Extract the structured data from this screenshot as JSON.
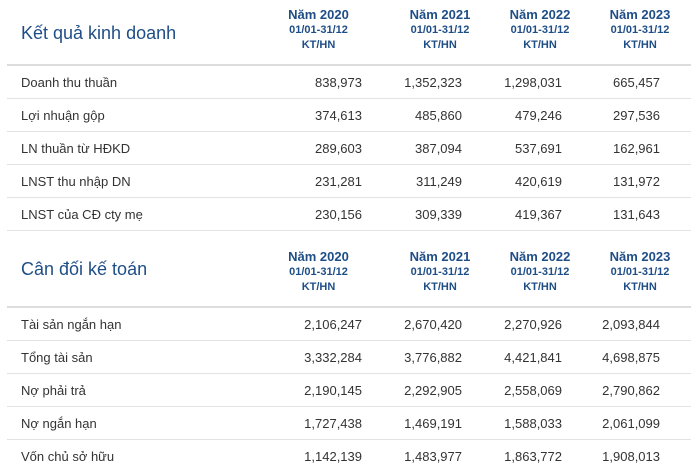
{
  "kqkd": {
    "title": "Kết quả kinh doanh",
    "columns": [
      {
        "year": "Năm 2020",
        "period": "01/01-31/12",
        "unit": "KT/HN"
      },
      {
        "year": "Năm 2021",
        "period": "01/01-31/12",
        "unit": "KT/HN"
      },
      {
        "year": "Năm 2022",
        "period": "01/01-31/12",
        "unit": "KT/HN"
      },
      {
        "year": "Năm 2023",
        "period": "01/01-31/12",
        "unit": "KT/HN"
      }
    ],
    "rows": [
      {
        "label": "Doanh thu thuần",
        "values": [
          "838,973",
          "1,352,323",
          "1,298,031",
          "665,457"
        ]
      },
      {
        "label": "Lợi nhuận gộp",
        "values": [
          "374,613",
          "485,860",
          "479,246",
          "297,536"
        ]
      },
      {
        "label": "LN thuần từ HĐKD",
        "values": [
          "289,603",
          "387,094",
          "537,691",
          "162,961"
        ]
      },
      {
        "label": "LNST thu nhập DN",
        "values": [
          "231,281",
          "311,249",
          "420,619",
          "131,972"
        ]
      },
      {
        "label": "LNST của CĐ cty mẹ",
        "values": [
          "230,156",
          "309,339",
          "419,367",
          "131,643"
        ]
      }
    ]
  },
  "cdkt": {
    "title": "Cân đối kế toán",
    "columns": [
      {
        "year": "Năm 2020",
        "period": "01/01-31/12",
        "unit": "KT/HN"
      },
      {
        "year": "Năm 2021",
        "period": "01/01-31/12",
        "unit": "KT/HN"
      },
      {
        "year": "Năm 2022",
        "period": "01/01-31/12",
        "unit": "KT/HN"
      },
      {
        "year": "Năm 2023",
        "period": "01/01-31/12",
        "unit": "KT/HN"
      }
    ],
    "rows": [
      {
        "label": "Tài sản ngắn hạn",
        "values": [
          "2,106,247",
          "2,670,420",
          "2,270,926",
          "2,093,844"
        ]
      },
      {
        "label": "Tổng tài sản",
        "values": [
          "3,332,284",
          "3,776,882",
          "4,421,841",
          "4,698,875"
        ]
      },
      {
        "label": "Nợ phải trả",
        "values": [
          "2,190,145",
          "2,292,905",
          "2,558,069",
          "2,790,862"
        ]
      },
      {
        "label": "Nợ ngắn hạn",
        "values": [
          "1,727,438",
          "1,469,191",
          "1,588,033",
          "2,061,099"
        ]
      },
      {
        "label": "Vốn chủ sở hữu",
        "values": [
          "1,142,139",
          "1,483,977",
          "1,863,772",
          "1,908,013"
        ]
      }
    ]
  }
}
